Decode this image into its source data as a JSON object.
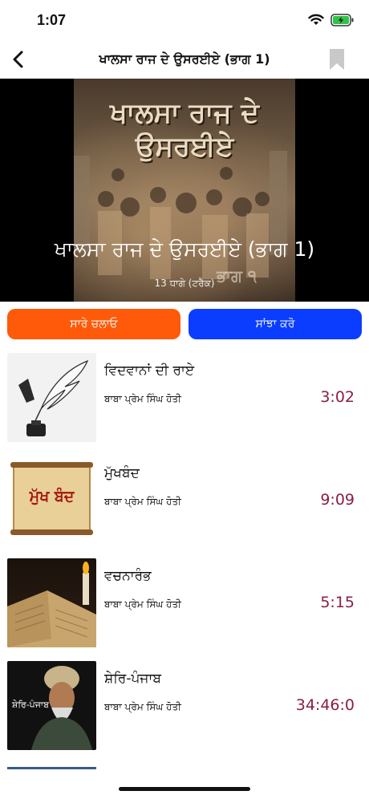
{
  "status_bar": {
    "time": "1:07"
  },
  "nav": {
    "title": "ਖਾਲਸਾ ਰਾਜ ਦੇ ਉਸਰਈਏ (ਭਾਗ 1)"
  },
  "hero": {
    "art_title": "ਖਾਲਸਾ ਰਾਜ ਦੇ\nਉਸਰਈਏ",
    "title": "ਖਾਲਸਾ ਰਾਜ ਦੇ ਉਸਰਈਏ (ਭਾਗ 1)",
    "subtitle": "13 ਧਾਗੇ (ਟਰੈਕ)",
    "art_part_label": "ਭਾਗ ੧"
  },
  "actions": {
    "play_all": "ਸਾਰੇ ਚਲਾਓ",
    "share": "ਸਾਂਝਾ ਕਰੋ"
  },
  "tracks": [
    {
      "title": "ਵਿਦਵਾਨਾਂ ਦੀ ਰਾਏ",
      "artist": "ਬਾਬਾ ਪ੍ਰੇਮ ਸਿੰਘ ਹੋਤੀ",
      "duration": "3:02",
      "thumb": "feather-pen"
    },
    {
      "title": "ਮੁੱਖਬੰਦ",
      "artist": "ਬਾਬਾ ਪ੍ਰੇਮ ਸਿੰਘ ਹੋਤੀ",
      "duration": "9:09",
      "thumb": "scroll",
      "thumb_text": "ਮੁੱਖ ਬੰਦ"
    },
    {
      "title": "ਵਚਨਾਰੰਭ",
      "artist": "ਬਾਬਾ ਪ੍ਰੇਮ ਸਿੰਘ ਹੋਤੀ",
      "duration": "5:15",
      "thumb": "book-candle"
    },
    {
      "title": "ਸ਼ੇਰਿ-ਪੰਜਾਬ",
      "artist": "ਬਾਬਾ ਪ੍ਰੇਮ ਸਿੰਘ ਹੋਤੀ",
      "duration": "34:46:0",
      "thumb": "portrait",
      "thumb_text": "ਸ਼ੇਰਿ-ਪੰਜਾਬ"
    }
  ],
  "colors": {
    "play_button": "#FF5A0A",
    "share_button": "#0A3DFF",
    "duration": "#8b1c47"
  }
}
